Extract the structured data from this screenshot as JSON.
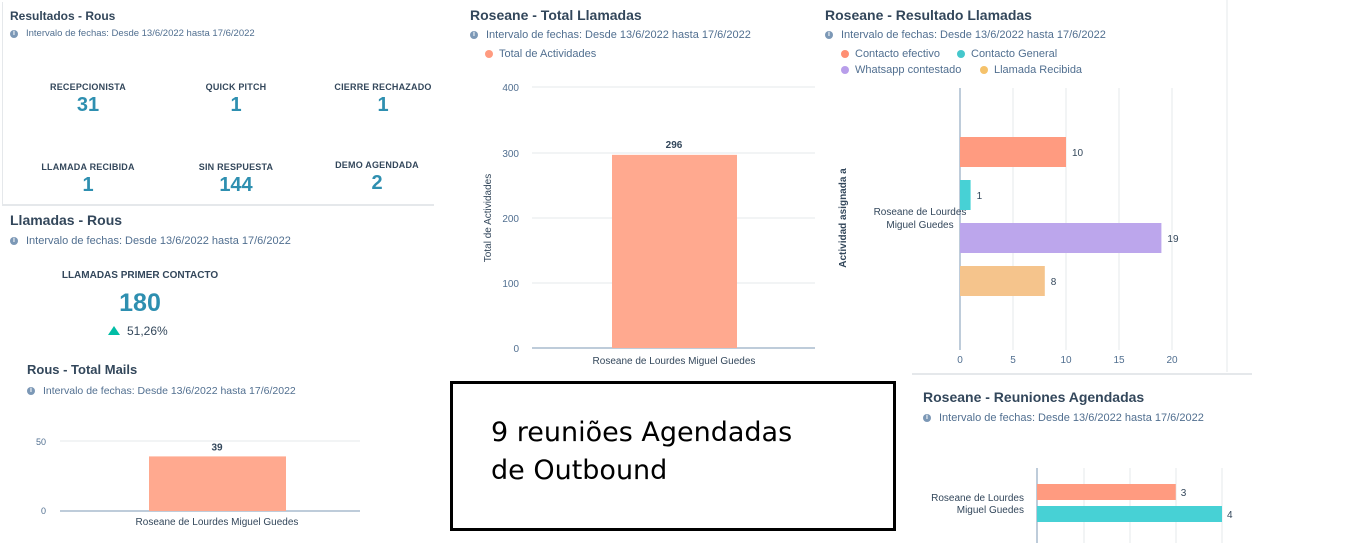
{
  "date_range": "Intervalo de fechas: Desde 13/6/2022 hasta 17/6/2022",
  "info_icon": "info-icon",
  "resultados": {
    "title": "Resultados - Rous",
    "kpis": [
      {
        "label": "RECEPCIONISTA",
        "value": "31"
      },
      {
        "label": "QUICK PITCH",
        "value": "1"
      },
      {
        "label": "CIERRE RECHAZADO",
        "value": "1"
      },
      {
        "label": "LLAMADA RECIBIDA",
        "value": "1"
      },
      {
        "label": "SIN RESPUESTA",
        "value": "144"
      },
      {
        "label": "DEMO AGENDADA",
        "value": "2"
      }
    ]
  },
  "llamadas": {
    "title": "Llamadas - Rous",
    "kpi_label": "LLAMADAS PRIMER CONTACTO",
    "kpi_value": "180",
    "change": "51,26%",
    "change_icon": "triangle-up-icon",
    "change_color": "#00bda5"
  },
  "total_mails": {
    "title": "Rous - Total Mails",
    "chart_data": {
      "type": "bar",
      "categories": [
        "Roseane de Lourdes Miguel Guedes"
      ],
      "values": [
        39
      ],
      "y_ticks": [
        "0",
        "50"
      ],
      "ylim": [
        0,
        50
      ],
      "data_labels": [
        "39"
      ],
      "color": "#ffa98f"
    }
  },
  "total_llamadas": {
    "title": "Roseane - Total Llamadas",
    "legend": [
      "Total de Actividades"
    ],
    "chart_data": {
      "type": "bar",
      "categories": [
        "Roseane de Lourdes Miguel Guedes"
      ],
      "series": [
        {
          "name": "Total de Actividades",
          "values": [
            296
          ]
        }
      ],
      "y_ticks": [
        "0",
        "100",
        "200",
        "300",
        "400"
      ],
      "ylim": [
        0,
        400
      ],
      "ylabel": "Total de Actividades",
      "data_labels": [
        "296"
      ],
      "color": "#ffa98f"
    }
  },
  "resultado_llamadas": {
    "title": "Roseane - Resultado Llamadas",
    "legend": [
      {
        "name": "Contacto efectivo",
        "color": "#ff8f73"
      },
      {
        "name": "Contacto General",
        "color": "#45c7cc"
      },
      {
        "name": "Whatsapp contestado",
        "color": "#b89eea"
      },
      {
        "name": "Llamada Recibida",
        "color": "#f5c26b"
      }
    ],
    "chart_data": {
      "type": "bar",
      "orientation": "horizontal",
      "categories": [
        "Roseane de Lourdes Miguel Guedes"
      ],
      "category_lines": [
        "Roseane de Lourdes",
        "Miguel Guedes"
      ],
      "series": [
        {
          "name": "Contacto efectivo",
          "values": [
            10
          ],
          "color": "#ff9b80"
        },
        {
          "name": "Contacto General",
          "values": [
            1
          ],
          "color": "#47d1d5"
        },
        {
          "name": "Whatsapp contestado",
          "values": [
            19
          ],
          "color": "#bca6ec"
        },
        {
          "name": "Llamada Recibida",
          "values": [
            8
          ],
          "color": "#f5c48c"
        }
      ],
      "x_ticks": [
        "0",
        "5",
        "10",
        "15",
        "20"
      ],
      "xlim": [
        0,
        20
      ],
      "ylabel": "Actividad asignada a",
      "data_labels": [
        "10",
        "1",
        "19",
        "8"
      ]
    }
  },
  "reuniones": {
    "title": "Roseane - Reuniones Agendadas",
    "chart_data": {
      "type": "bar",
      "orientation": "horizontal",
      "categories": [
        "Roseane de Lourdes Miguel Guedes"
      ],
      "category_lines": [
        "Roseane de Lourdes",
        "Miguel Guedes"
      ],
      "series": [
        {
          "values": [
            3
          ],
          "color": "#ff9b80"
        },
        {
          "values": [
            4
          ],
          "color": "#47d1d5"
        }
      ],
      "xlim": [
        0,
        4
      ],
      "data_labels": [
        "3",
        "4"
      ]
    }
  },
  "note": {
    "line1": "9 reuniões Agendadas",
    "line2": "de Outbound"
  }
}
